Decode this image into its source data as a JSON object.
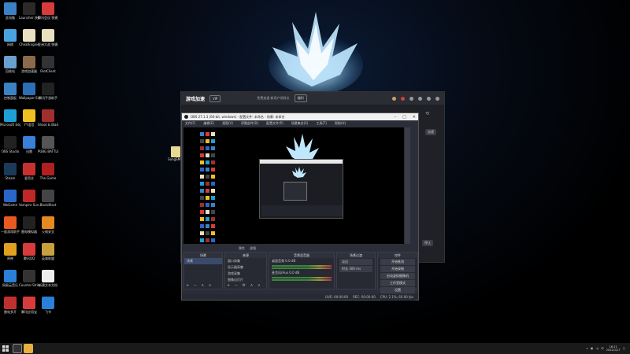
{
  "desktop_icons": [
    {
      "label": "此电脑",
      "color": "#3b82c4"
    },
    {
      "label": "Launcher 快捷方式",
      "color": "#2a2a2a"
    },
    {
      "label": "腾讯会议 快捷方式",
      "color": "#d83b3b"
    },
    {
      "label": "网络",
      "color": "#4aa3e0"
    },
    {
      "label": "CheatEngine",
      "color": "#e8e0c0"
    },
    {
      "label": "亚洲大战 快捷方式",
      "color": "#e8e0c0"
    },
    {
      "label": "回收站",
      "color": "#6aa0d0"
    },
    {
      "label": "游戏加速器",
      "color": "#8a6a4a"
    },
    {
      "label": "RiotClient",
      "color": "#333"
    },
    {
      "label": "控制面板",
      "color": "#3b82c4"
    },
    {
      "label": "Wallpaper Engine",
      "color": "#2d6fb5"
    },
    {
      "label": "腾讯手游助手",
      "color": "#222"
    },
    {
      "label": "Microsoft Edge",
      "color": "#1f9fd6"
    },
    {
      "label": "YY语音",
      "color": "#f0c020"
    },
    {
      "label": "Shoot & Blade",
      "color": "#a03030"
    },
    {
      "label": "OBS Studio",
      "color": "#222"
    },
    {
      "label": "迅雷",
      "color": "#3a7fd8"
    },
    {
      "label": "PUBG BATTLEGR",
      "color": "#555"
    },
    {
      "label": "Steam",
      "color": "#1b3a5a"
    },
    {
      "label": "爱奇艺",
      "color": "#c83030"
    },
    {
      "label": "The Game",
      "color": "#b02020"
    },
    {
      "label": "WeGame",
      "color": "#2a66c8"
    },
    {
      "label": "Vampire Survivors",
      "color": "#c02828"
    },
    {
      "label": "BlockBlast",
      "color": "#444"
    },
    {
      "label": "一般游戏助手",
      "color": "#e85a20"
    },
    {
      "label": "雷电模拟器",
      "color": "#222"
    },
    {
      "label": "火绒安全",
      "color": "#e88820"
    },
    {
      "label": "原神",
      "color": "#e0a020"
    },
    {
      "label": "腾讯QQ",
      "color": "#d83b3b"
    },
    {
      "label": "英雄联盟",
      "color": "#c8a040"
    },
    {
      "label": "网易云音乐",
      "color": "#2a7fd8"
    },
    {
      "label": "Counter-Strike",
      "color": "#333"
    },
    {
      "label": "新建文本文档",
      "color": "#eee"
    },
    {
      "label": "雷电多开",
      "color": "#c03030"
    },
    {
      "label": "腾讯应用宝",
      "color": "#d83b3b"
    },
    {
      "label": "飞书",
      "color": "#2a7fd8"
    }
  ],
  "file_on_desktop": {
    "label": "SongSM...",
    "color": "#e8d890"
  },
  "app_window": {
    "brand": "游戏加速",
    "chip": "VIP",
    "center_text": "免费加速·新用户领时长",
    "chip2": "福利",
    "side_btn1": "加速",
    "side_btn2": "停止"
  },
  "obs": {
    "title": "OBS 27.1.3 (64-bit, windows) - 配置文件: 未命名 - 场景: 未命名",
    "menu": [
      "文件(F)",
      "编辑(E)",
      "视图(V)",
      "停靠部件(D)",
      "配置文件(P)",
      "场景集合(S)",
      "工具(T)",
      "帮助(H)"
    ],
    "ctrl_labels": [
      "属性",
      "滤镜"
    ],
    "docks": {
      "scenes": {
        "title": "场景",
        "items": [
          "场景"
        ]
      },
      "sources": {
        "title": "来源",
        "items": [
          "窗口采集",
          "显示器采集",
          "游戏采集",
          "图像幻灯片"
        ]
      },
      "mixer": {
        "title": "音频混音器",
        "items": [
          "桌面音频 0.0 dB",
          "麦克风/Aux 0.0 dB"
        ]
      },
      "transitions": {
        "title": "场景过渡",
        "items": [
          "淡出",
          "时长 300 ms"
        ]
      },
      "controls": {
        "title": "控件",
        "buttons": [
          "开始推流",
          "开始录制",
          "启动虚拟摄像机",
          "工作室模式",
          "设置",
          "退出"
        ]
      }
    },
    "status": [
      "LIVE: 00:00:00",
      "REC: 00:00:00",
      "CPU: 2.1%, 60.00 fps"
    ]
  },
  "taskbar": {
    "clock_time": "16:21",
    "clock_date": "2022/1/27"
  }
}
